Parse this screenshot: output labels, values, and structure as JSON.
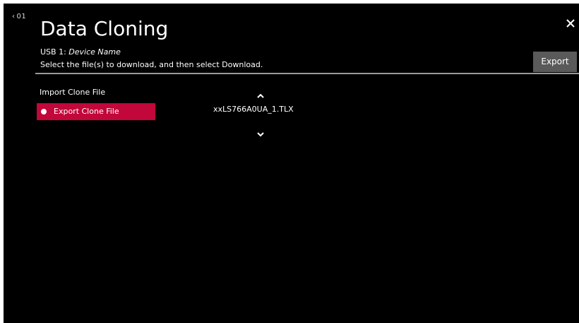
{
  "header": {
    "back_label": "01",
    "title": "Data Cloning",
    "device_prefix": "USB 1:",
    "device_name": "Device Name",
    "instruction": "Select the file(s) to download, and then select Download.",
    "export_button": "Export"
  },
  "menu": {
    "items": [
      {
        "label": "Import Clone File",
        "selected": false
      },
      {
        "label": "Export Clone File",
        "selected": true
      }
    ]
  },
  "file_list": {
    "current_file": "xxLS766A0UA_1.TLX"
  },
  "colors": {
    "background": "#000000",
    "selected_item": "#c2073a",
    "button": "#5a5a5a",
    "divider": "#9a9a9a"
  },
  "icons": {
    "back": "chevron-left-icon",
    "close": "close-icon",
    "scroll_up": "chevron-up-icon",
    "scroll_down": "chevron-down-icon",
    "selected_marker": "radio-dot-icon"
  }
}
